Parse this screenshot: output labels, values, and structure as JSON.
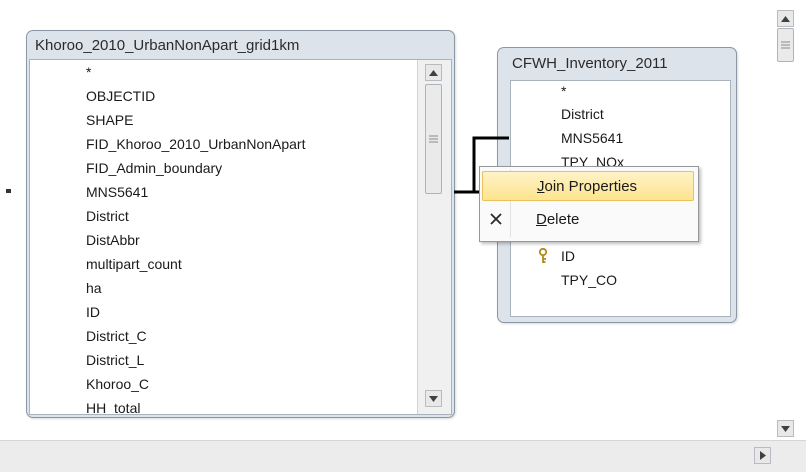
{
  "table_left": {
    "title": "Khoroo_2010_UrbanNonApart_grid1km",
    "fields": [
      "*",
      "OBJECTID",
      "SHAPE",
      "FID_Khoroo_2010_UrbanNonApart",
      "FID_Admin_boundary",
      "MNS5641",
      "District",
      "DistAbbr",
      "multipart_count",
      "ha",
      "ID",
      "District_C",
      "District_L",
      "Khoroo_C",
      "HH_total"
    ]
  },
  "table_right": {
    "title": "CFWH_Inventory_2011",
    "fields": [
      "*",
      "District",
      "MNS5641",
      "TPY_NOx",
      "",
      "",
      "ID",
      "TPY_CO"
    ],
    "key_field": "ID"
  },
  "context_menu": {
    "items": [
      {
        "label_first": "J",
        "label_rest": "oin Properties",
        "icon": "",
        "highlighted": true
      },
      {
        "label_first": "D",
        "label_rest": "elete",
        "icon": "delete-x-icon",
        "highlighted": false
      }
    ]
  },
  "icons": {
    "scroll_up": "triangle-up-icon",
    "scroll_down": "triangle-down-icon",
    "scroll_right": "triangle-right-icon",
    "key": "key-icon",
    "delete": "x-icon"
  },
  "colors": {
    "window_bg": "#dde3ea",
    "highlight": "#fde48f",
    "join_line": "#000000"
  }
}
